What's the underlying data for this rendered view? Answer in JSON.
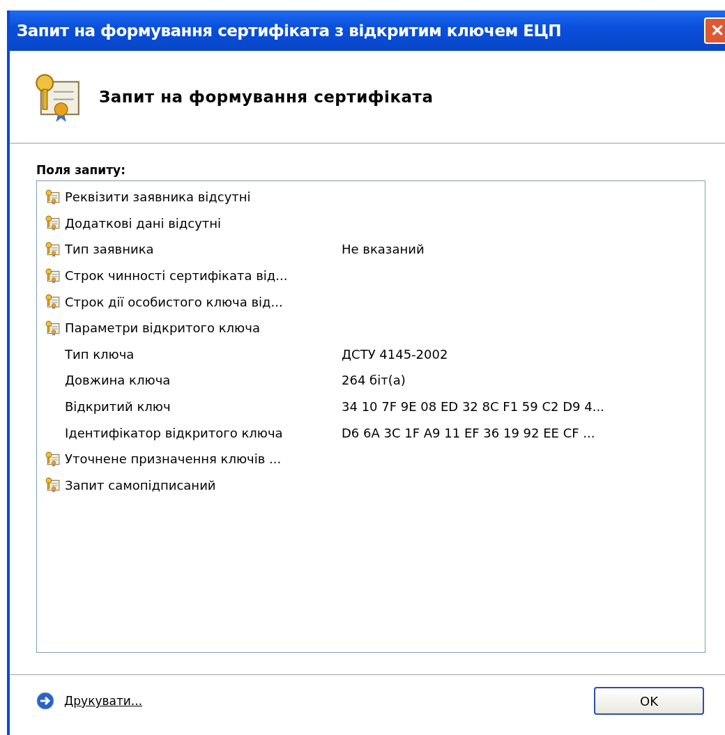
{
  "window": {
    "title": "Запит на формування сертифіката з відкритим ключем ЕЦП",
    "close": "✕"
  },
  "header": {
    "title": "Запит на формування сертифіката"
  },
  "fields": {
    "label": "Поля запиту:",
    "items": [
      {
        "name": "Реквізити заявника відсутні"
      },
      {
        "name": "Додаткові дані відсутні"
      },
      {
        "name": "Тип заявника",
        "value": "Не вказаний"
      },
      {
        "name": "Строк чинності сертифіката від..."
      },
      {
        "name": "Строк дії особистого ключа від..."
      },
      {
        "name": "Параметри відкритого ключа",
        "children": [
          {
            "name": "Тип ключа",
            "value": "ДСТУ 4145-2002"
          },
          {
            "name": "Довжина ключа",
            "value": "264 біт(а)"
          },
          {
            "name": "Відкритий ключ",
            "value": "34 10 7F 9E 08 ED 32 8C F1 59 C2 D9 4..."
          },
          {
            "name": "Ідентифікатор відкритого ключа",
            "value": "D6 6A 3C 1F A9 11 EF 36 19 92 EE CF ..."
          }
        ]
      },
      {
        "name": "Уточнене призначення ключів ..."
      },
      {
        "name": "Запит самопідписаний"
      }
    ]
  },
  "footer": {
    "print_link": "Друкувати...",
    "ok_button": "OK"
  }
}
